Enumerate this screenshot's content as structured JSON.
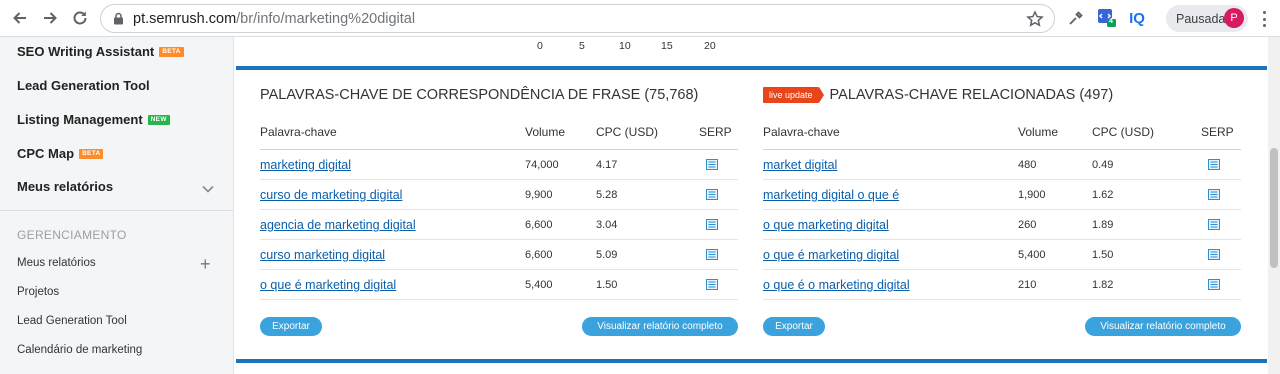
{
  "browser": {
    "url_host": "pt.semrush.com",
    "url_path": "/br/info/marketing%20digital",
    "profile_status": "Pausada",
    "profile_initial": "P",
    "iq_label": "IQ",
    "ext_badge": "4"
  },
  "sidebar": {
    "top_items": [
      {
        "label": "SEO Writing Assistant",
        "badge": "BETA"
      },
      {
        "label": "Lead Generation Tool"
      },
      {
        "label": "Listing Management",
        "badge": "NEW"
      },
      {
        "label": "CPC Map",
        "badge": "BETA"
      },
      {
        "label": "Meus relatórios"
      }
    ],
    "section_title": "GERENCIAMENTO",
    "sub_items": [
      {
        "label": "Meus relatórios"
      },
      {
        "label": "Projetos"
      },
      {
        "label": "Lead Generation Tool"
      },
      {
        "label": "Calendário de marketing"
      }
    ]
  },
  "axis_ticks": [
    "0",
    "5",
    "10",
    "15",
    "20"
  ],
  "panels": [
    {
      "title": "PALAVRAS-CHAVE DE CORRESPONDÊNCIA DE FRASE (75,768)",
      "columns": [
        "Palavra-chave",
        "Volume",
        "CPC (USD)",
        "SERP"
      ],
      "rows": [
        {
          "keyword": "marketing digital",
          "volume": "74,000",
          "cpc": "4.17"
        },
        {
          "keyword": "curso de marketing digital",
          "volume": "9,900",
          "cpc": "5.28"
        },
        {
          "keyword": "agencia de marketing digital",
          "volume": "6,600",
          "cpc": "3.04"
        },
        {
          "keyword": "curso marketing digital",
          "volume": "6,600",
          "cpc": "5.09"
        },
        {
          "keyword": "o que é marketing digital",
          "volume": "5,400",
          "cpc": "1.50"
        }
      ],
      "export_label": "Exportar",
      "full_report_label": "Visualizar relatório completo"
    },
    {
      "badge": "live update",
      "title": "PALAVRAS-CHAVE RELACIONADAS (497)",
      "columns": [
        "Palavra-chave",
        "Volume",
        "CPC (USD)",
        "SERP"
      ],
      "rows": [
        {
          "keyword": "market digital",
          "volume": "480",
          "cpc": "0.49"
        },
        {
          "keyword": "marketing digital o que é",
          "volume": "1,900",
          "cpc": "1.62"
        },
        {
          "keyword": "o que marketing digital",
          "volume": "260",
          "cpc": "1.89"
        },
        {
          "keyword": "o que é marketing digital",
          "volume": "5,400",
          "cpc": "1.50"
        },
        {
          "keyword": "o que é o marketing digital",
          "volume": "210",
          "cpc": "1.82"
        }
      ],
      "export_label": "Exportar",
      "full_report_label": "Visualizar relatório completo"
    }
  ],
  "colors": {
    "accent_blue": "#1c75bc",
    "button_blue": "#3aa3dd",
    "link_blue": "#0b5fab",
    "live_badge": "#e8451b",
    "beta_badge": "#ff8c2a",
    "new_badge": "#27b44a"
  }
}
